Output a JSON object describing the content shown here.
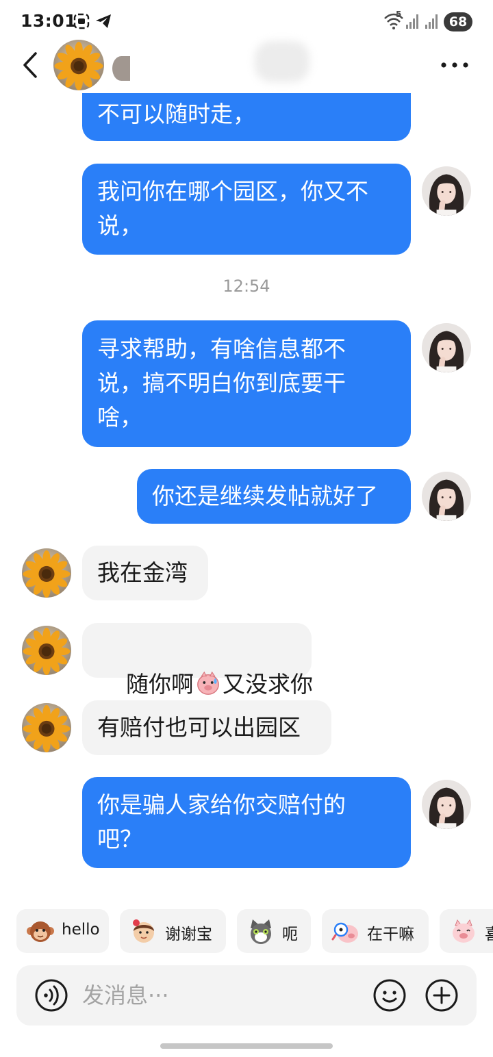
{
  "status_bar": {
    "time": "13:01",
    "battery": "68",
    "wifi_badge": "5"
  },
  "header": {
    "back_icon": "chevron-left-icon",
    "more_icon": "more-dots-icon"
  },
  "messages": [
    {
      "side": "out",
      "lines": "不可以随时走，",
      "avatar": false
    },
    {
      "side": "out",
      "lines": "我问你在哪个园区，你又不\n说，",
      "avatar": true
    },
    {
      "side": "time",
      "text": "12:54"
    },
    {
      "side": "out",
      "lines": "寻求帮助，有啥信息都不\n说，搞不明白你到底要干\n啥，",
      "avatar": true
    },
    {
      "side": "out",
      "lines": "你还是继续发帖就好了",
      "avatar": true
    },
    {
      "side": "in",
      "lines": "我在金湾",
      "avatar": true
    },
    {
      "side": "in",
      "before_emoji": "随你啊",
      "emoji": "sweating-pig-emoji",
      "after_emoji": "又没求你",
      "avatar": true
    },
    {
      "side": "in",
      "lines": "有赔付也可以出园区",
      "avatar": true
    },
    {
      "side": "out",
      "lines": "你是骗人家给你交赔付的\n吧？",
      "avatar": true
    }
  ],
  "quick_replies": [
    {
      "label": "hello",
      "icon": "monkey-sticker-icon"
    },
    {
      "label": "谢谢宝",
      "icon": "girl-rose-sticker-icon"
    },
    {
      "label": "呃",
      "icon": "cat-sticker-icon"
    },
    {
      "label": "在干嘛",
      "icon": "magnifier-pig-sticker-icon"
    },
    {
      "label": "喜",
      "icon": "pig-sticker-icon"
    }
  ],
  "input": {
    "placeholder": "发消息···"
  },
  "colors": {
    "outgoing_bubble": "#2a7ff8",
    "incoming_bubble": "#f3f3f3",
    "timestamp": "#9a9a9a"
  }
}
